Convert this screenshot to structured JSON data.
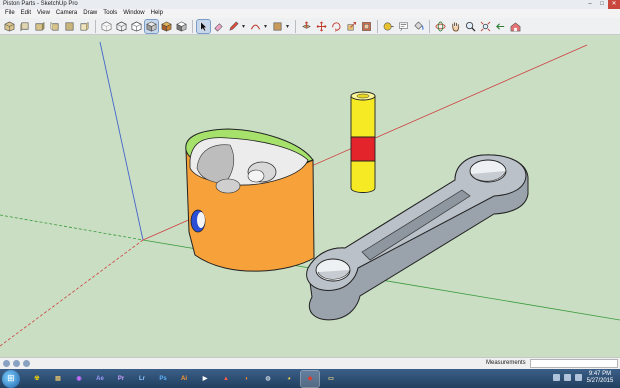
{
  "window": {
    "title": "Piston Parts - SketchUp Pro"
  },
  "title_buttons": {
    "minimize": "–",
    "maximize": "□",
    "close": "✕"
  },
  "menu": [
    "File",
    "Edit",
    "View",
    "Camera",
    "Draw",
    "Tools",
    "Window",
    "Help"
  ],
  "toolbar": {
    "tools": [
      {
        "name": "iso-view-tool",
        "icon": "iso-cube"
      },
      {
        "name": "top-view-tool",
        "icon": "top-view"
      },
      {
        "name": "front-view-tool",
        "icon": "front-view"
      },
      {
        "name": "right-view-tool",
        "icon": "right-view"
      },
      {
        "name": "back-view-tool",
        "icon": "back-view"
      },
      {
        "name": "left-view-tool",
        "icon": "left-view"
      },
      {
        "name": "xray-style-tool",
        "icon": "xray"
      },
      {
        "name": "wireframe-style-tool",
        "icon": "wireframe"
      },
      {
        "name": "hidden-line-style-tool",
        "icon": "hidden-line"
      },
      {
        "name": "shaded-style-tool",
        "icon": "shaded"
      },
      {
        "name": "shaded-textures-style-tool",
        "icon": "textures"
      },
      {
        "name": "monochrome-style-tool",
        "icon": "monochrome"
      },
      {
        "name": "select-tool",
        "icon": "arrow",
        "selected": true
      },
      {
        "name": "eraser-tool",
        "icon": "eraser"
      },
      {
        "name": "line-tool",
        "icon": "pencil"
      },
      {
        "name": "arc-tool",
        "icon": "arc"
      },
      {
        "name": "rectangle-tool",
        "icon": "rectangle"
      },
      {
        "name": "push-pull-tool",
        "icon": "push-pull"
      },
      {
        "name": "move-tool",
        "icon": "move"
      },
      {
        "name": "rotate-tool",
        "icon": "rotate"
      },
      {
        "name": "scale-tool",
        "icon": "scale"
      },
      {
        "name": "offset-tool",
        "icon": "offset"
      },
      {
        "name": "tape-measure-tool",
        "icon": "tape"
      },
      {
        "name": "text-tool",
        "icon": "text"
      },
      {
        "name": "paint-bucket-tool",
        "icon": "paint"
      },
      {
        "name": "orbit-tool",
        "icon": "orbit"
      },
      {
        "name": "pan-tool",
        "icon": "hand"
      },
      {
        "name": "zoom-tool",
        "icon": "magnifier"
      },
      {
        "name": "zoom-extents-tool",
        "icon": "zoom-extents"
      },
      {
        "name": "previous-view-tool",
        "icon": "previous"
      },
      {
        "name": "warehouse-tool",
        "icon": "warehouse"
      }
    ]
  },
  "status": {
    "measurements_label": "Measurements",
    "measurements_value": ""
  },
  "taskbar": {
    "apps": [
      {
        "name": "start-orb",
        "label": ""
      },
      {
        "name": "biohazard-app",
        "label": "☢",
        "color": "#f1d200"
      },
      {
        "name": "explorer-app",
        "label": "▤",
        "color": "#e9c36b"
      },
      {
        "name": "media-app",
        "label": "◉",
        "color": "#c86cff"
      },
      {
        "name": "after-effects-app",
        "label": "Ae",
        "color": "#9b9bff"
      },
      {
        "name": "premiere-app",
        "label": "Pr",
        "color": "#c8a0ff"
      },
      {
        "name": "lightroom-app",
        "label": "Lr",
        "color": "#8cc6ff"
      },
      {
        "name": "photoshop-app",
        "label": "Ps",
        "color": "#5fb4ff"
      },
      {
        "name": "illustrator-app",
        "label": "Ai",
        "color": "#ff9a2e"
      },
      {
        "name": "media-player-app",
        "label": "▶",
        "color": "#ffffff"
      },
      {
        "name": "autodesk-app",
        "label": "▲",
        "color": "#ff5a4a"
      },
      {
        "name": "blender-app",
        "label": "◐",
        "color": "#ff8a2e"
      },
      {
        "name": "settings-app",
        "label": "◍",
        "color": "#b9c6d6"
      },
      {
        "name": "chrome-app",
        "label": "◕",
        "color": "#f2c94c"
      },
      {
        "name": "sketchup-app",
        "label": "◆",
        "color": "#e4392b",
        "active": true
      },
      {
        "name": "file-explorer-app",
        "label": "▭",
        "color": "#f0d98b"
      }
    ],
    "clock_time": "9:47 PM",
    "clock_date": "5/27/2015"
  },
  "colors": {
    "viewport_bg": "#c9dec3",
    "piston_orange": "#f7a13a",
    "piston_green": "#a6e26b",
    "pin_yellow": "#f6ea24",
    "pin_red": "#e3242b",
    "rod_grey": "#aeb4bb"
  }
}
